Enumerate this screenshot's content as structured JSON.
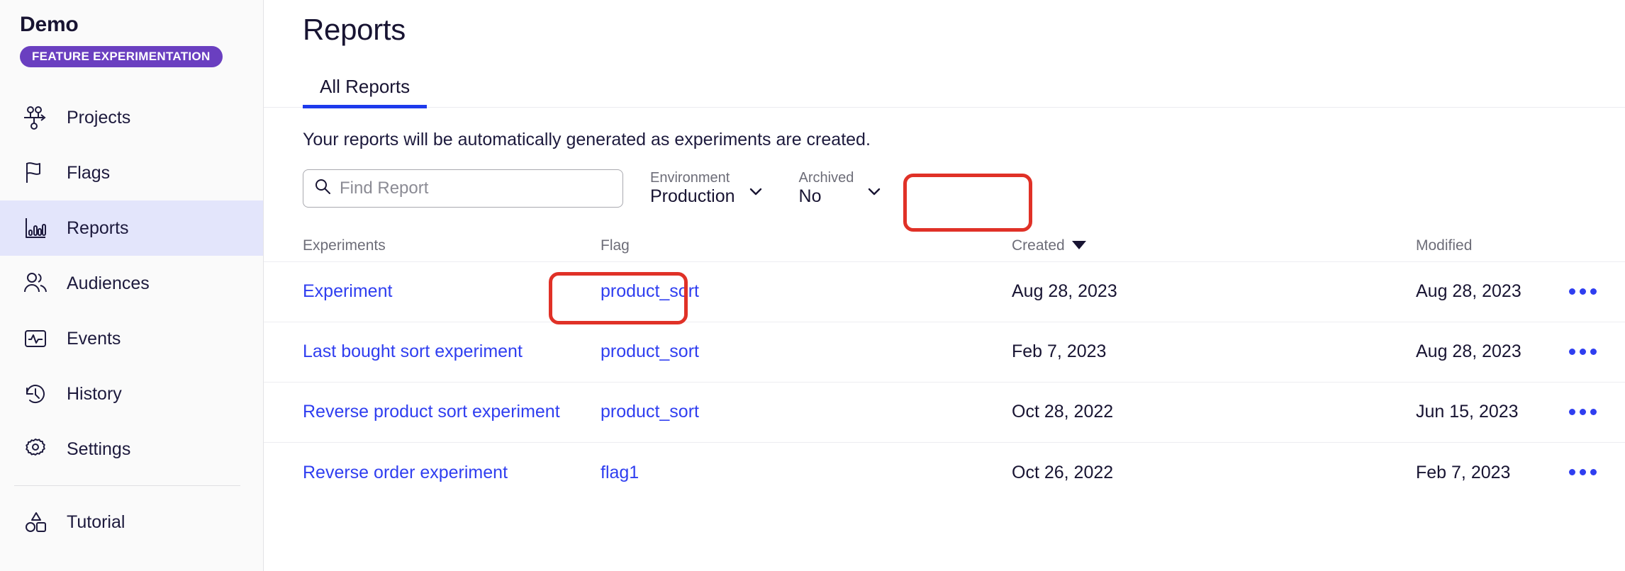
{
  "sidebar": {
    "brand_title": "Demo",
    "brand_badge": "FEATURE EXPERIMENTATION",
    "items": [
      {
        "label": "Projects",
        "icon": "projects-icon"
      },
      {
        "label": "Flags",
        "icon": "flag-icon"
      },
      {
        "label": "Reports",
        "icon": "bar-chart-icon"
      },
      {
        "label": "Audiences",
        "icon": "people-icon"
      },
      {
        "label": "Events",
        "icon": "pulse-monitor-icon"
      },
      {
        "label": "History",
        "icon": "clock-rewind-icon"
      },
      {
        "label": "Settings",
        "icon": "gear-icon"
      },
      {
        "label": "Tutorial",
        "icon": "shapes-icon"
      }
    ],
    "active_item": "Reports"
  },
  "main": {
    "page_title": "Reports",
    "tabs": [
      {
        "label": "All Reports",
        "active": true
      }
    ],
    "blurb": "Your reports will be automatically generated as experiments are created.",
    "search": {
      "placeholder": "Find Report",
      "value": ""
    },
    "filters": [
      {
        "label": "Environment",
        "value": "Production"
      },
      {
        "label": "Archived",
        "value": "No"
      }
    ],
    "table": {
      "headers": {
        "experiments": "Experiments",
        "flag": "Flag",
        "created": "Created",
        "modified": "Modified"
      },
      "sorted_by": "Created",
      "sort_direction": "desc",
      "rows": [
        {
          "experiment": "Experiment",
          "flag": "product_sort",
          "created": "Aug 28, 2023",
          "modified": "Aug 28, 2023"
        },
        {
          "experiment": "Last bought sort experiment",
          "flag": "product_sort",
          "created": "Feb 7, 2023",
          "modified": "Aug 28, 2023"
        },
        {
          "experiment": "Reverse product sort experiment",
          "flag": "product_sort",
          "created": "Oct 28, 2022",
          "modified": "Jun 15, 2023"
        },
        {
          "experiment": "Reverse order experiment",
          "flag": "flag1",
          "created": "Oct 26, 2022",
          "modified": "Feb 7, 2023"
        }
      ]
    }
  },
  "annotations": {
    "highlight_color": "#e03127",
    "highlighted": [
      "Environment filter",
      "Experiment link"
    ]
  },
  "colors": {
    "brand_purple": "#6a3fc0",
    "link_blue": "#2f3ef0",
    "tab_underline": "#1d3aec",
    "active_nav_bg": "#e3e5fb",
    "text_dark": "#181432",
    "text_muted": "#6d6d78"
  }
}
